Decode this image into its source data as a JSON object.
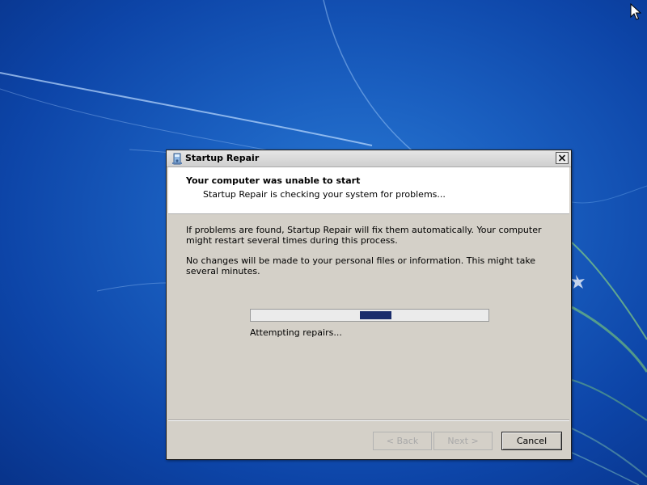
{
  "window": {
    "title": "Startup Repair",
    "title_icon": "startup-repair-icon",
    "close_icon": "close-icon"
  },
  "header": {
    "title": "Your computer was unable to start",
    "subtitle": "Startup Repair is checking your system for problems..."
  },
  "body": {
    "paragraph1": "If problems are found, Startup Repair will fix them automatically. Your computer might restart several times during this process.",
    "paragraph2": "No changes will be made to your personal files or information. This might take several minutes."
  },
  "progress": {
    "mode": "indeterminate",
    "status": "Attempting repairs..."
  },
  "buttons": {
    "back": {
      "label": "< Back",
      "enabled": false
    },
    "next": {
      "label": "Next >",
      "enabled": false
    },
    "cancel": {
      "label": "Cancel",
      "enabled": true
    }
  },
  "colors": {
    "desktop": "#1a5fc0",
    "dialog_face": "#d4d0c8",
    "progress_fill": "#1a2c6b"
  }
}
